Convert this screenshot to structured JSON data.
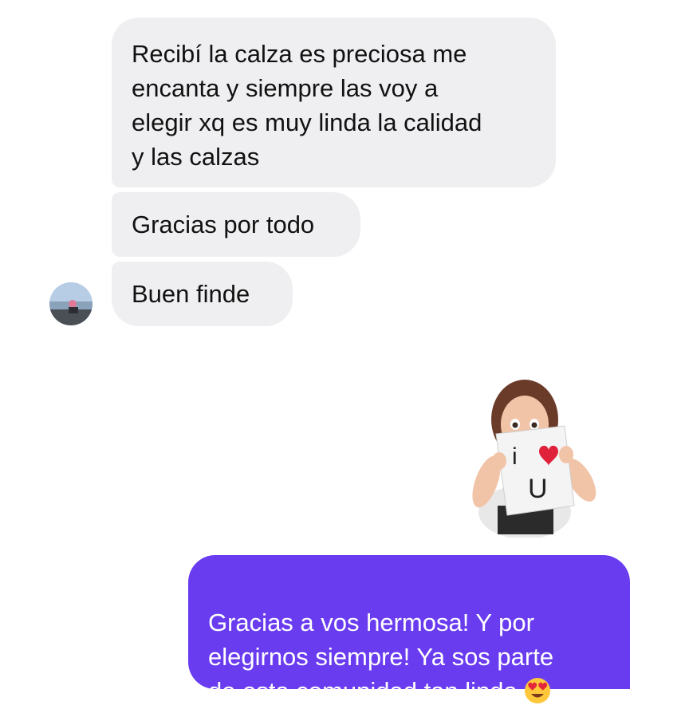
{
  "conversation": {
    "incoming": [
      {
        "text": "Recibí la calza es preciosa  me\nencanta y siempre  las voy a\nelegir xq es muy linda la calidad\ny las calzas"
      },
      {
        "text": "Gracias por todo"
      },
      {
        "text": "Buen  finde"
      }
    ],
    "sticker": {
      "icon": "heart-eyes-sticker-girl-icon",
      "sign_text_top": "i",
      "sign_text_bottom": "U"
    },
    "outgoing": [
      {
        "text": "Gracias a vos hermosa! Y por\nelegirnos siempre! Ya sos parte\nde esta comunidad tan linda ",
        "emoji": "heart-eyes-emoji-icon"
      }
    ]
  },
  "colors": {
    "incoming_bubble": "#efeff1",
    "outgoing_bubble": "#6a3cf0",
    "outgoing_text": "#ffffff",
    "incoming_text": "#111111"
  }
}
